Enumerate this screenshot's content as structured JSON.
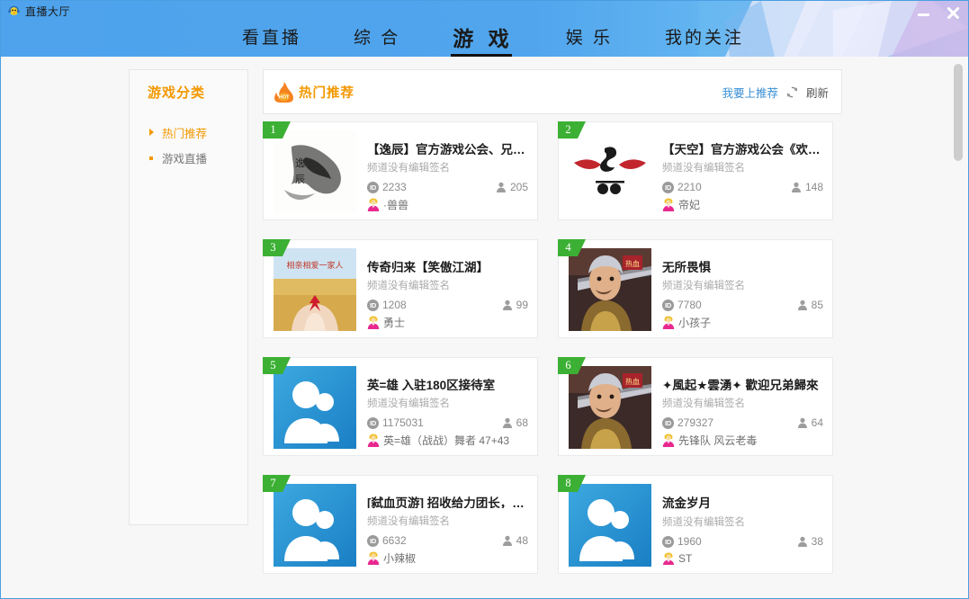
{
  "window": {
    "app_title": "直播大厅",
    "app_icon": "chick-headphone-icon",
    "minimize_label": "minimize",
    "close_label": "close"
  },
  "nav": {
    "items": [
      {
        "label": "看直播",
        "active": false
      },
      {
        "label": "综 合",
        "active": false
      },
      {
        "label": "游 戏",
        "active": true
      },
      {
        "label": "娱 乐",
        "active": false
      },
      {
        "label": "我的关注",
        "active": false
      }
    ]
  },
  "sidebar": {
    "title": "游戏分类",
    "items": [
      {
        "label": "热门推荐",
        "active": true
      },
      {
        "label": "游戏直播",
        "active": false
      }
    ]
  },
  "panel": {
    "title": "热门推荐",
    "hot_icon": "hot-flame-icon",
    "recommend_link": "我要上推荐",
    "refresh_icon": "refresh-icon",
    "refresh_label": "刷新"
  },
  "colors": {
    "accent_orange": "#f39800",
    "link_blue": "#3a8fd4",
    "rank_green": "#3cb034",
    "header_blue": "#4ea3ec"
  },
  "cards": [
    {
      "rank": "1",
      "title": "【逸辰】官方游戏公会、兄弟…",
      "signature": "频道没有编辑签名",
      "id": "2233",
      "viewers": "205",
      "user": "·兽兽",
      "thumb": "ink-painting"
    },
    {
      "rank": "2",
      "title": "【天空】官方游戏公会《欢迎…",
      "signature": "频道没有编辑签名",
      "id": "2210",
      "viewers": "148",
      "user": "帝妃",
      "thumb": "red-wing-logo"
    },
    {
      "rank": "3",
      "title": "传奇归来【笑傲江湖】",
      "signature": "频道没有编辑签名",
      "id": "1208",
      "viewers": "99",
      "user": "勇士",
      "thumb": "hands-field"
    },
    {
      "rank": "4",
      "title": "无所畏惧",
      "signature": "频道没有编辑签名",
      "id": "7780",
      "viewers": "85",
      "user": "小孩子",
      "thumb": "warrior"
    },
    {
      "rank": "5",
      "title": "英=雄 入驻180区接待室",
      "signature": "频道没有编辑签名",
      "id": "1175031",
      "viewers": "68",
      "user": "英=雄（战战）舞者 47+43",
      "thumb": "default-avatar"
    },
    {
      "rank": "6",
      "title": "✦風起★雲湧✦ 歡迎兄弟歸來",
      "signature": "频道没有编辑签名",
      "id": "279327",
      "viewers": "64",
      "user": "先锋队 风云老毒",
      "thumb": "warrior"
    },
    {
      "rank": "7",
      "title": "[弑血页游] 招收给力团长，军…",
      "signature": "频道没有编辑签名",
      "id": "6632",
      "viewers": "48",
      "user": "小辣椒",
      "thumb": "default-avatar"
    },
    {
      "rank": "8",
      "title": "流金岁月",
      "signature": "频道没有编辑签名",
      "id": "1960",
      "viewers": "38",
      "user": "ST",
      "thumb": "default-avatar"
    }
  ]
}
